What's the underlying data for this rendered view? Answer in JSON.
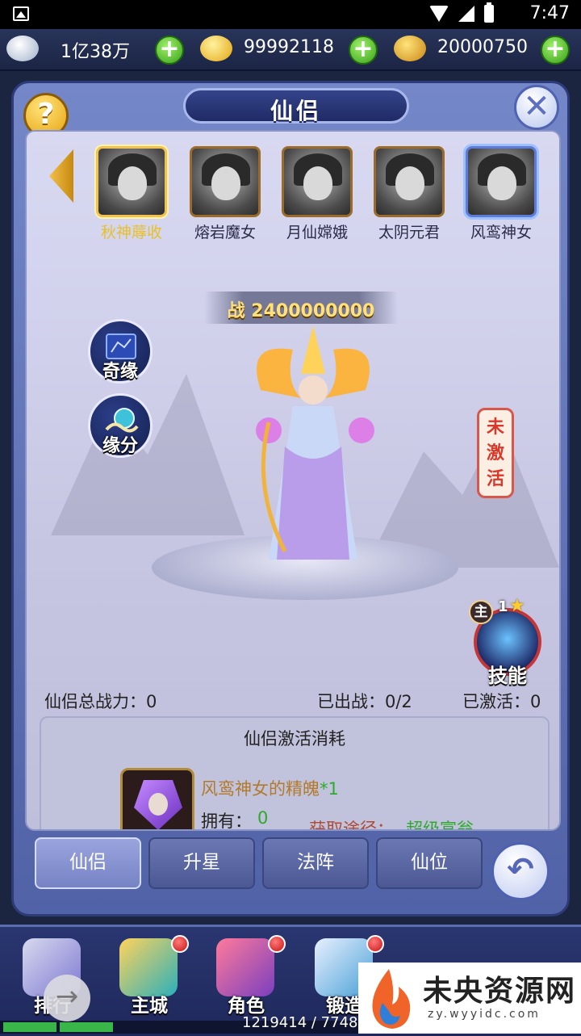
{
  "status_bar": {
    "time": "7:47"
  },
  "currency": {
    "silver": "1亿38万",
    "gold": "99992118",
    "bound_gold": "20000750"
  },
  "panel": {
    "title": "仙侣"
  },
  "characters": [
    {
      "name": "秋神蓐收"
    },
    {
      "name": "熔岩魔女"
    },
    {
      "name": "月仙嫦娥"
    },
    {
      "name": "太阴元君"
    },
    {
      "name": "风鸾神女"
    }
  ],
  "stage": {
    "power_label": "战 2400000000",
    "side_buttons": {
      "qiyuan": "奇缘",
      "yuanfen": "缘分"
    },
    "inactive_tag": "未激活",
    "skill": {
      "main_badge": "主",
      "level": "1",
      "label": "技能"
    }
  },
  "stats": {
    "total_power": "仙侣总战力：0",
    "deployed": "已出战：0/2",
    "activated": "已激活：0"
  },
  "cost": {
    "title": "仙侣激活消耗",
    "item_name": "风鸾神女的精魄",
    "item_count": "*1",
    "owned_label": "拥有：",
    "owned_value": "0",
    "source_label": "获取途径：",
    "source_link": "超级富翁"
  },
  "tabs": [
    "仙侣",
    "升星",
    "法阵",
    "仙位"
  ],
  "nav": {
    "items": [
      "排行",
      "主城",
      "角色",
      "锻造"
    ],
    "exp_text": "1219414 / 7748773"
  },
  "watermark": {
    "title": "未央资源网",
    "url": "zy.wyyidc.com"
  },
  "colors": {
    "accent_gold": "#e8c02a",
    "inactive_red": "#d9382a",
    "link_green": "#2eaa2a"
  }
}
